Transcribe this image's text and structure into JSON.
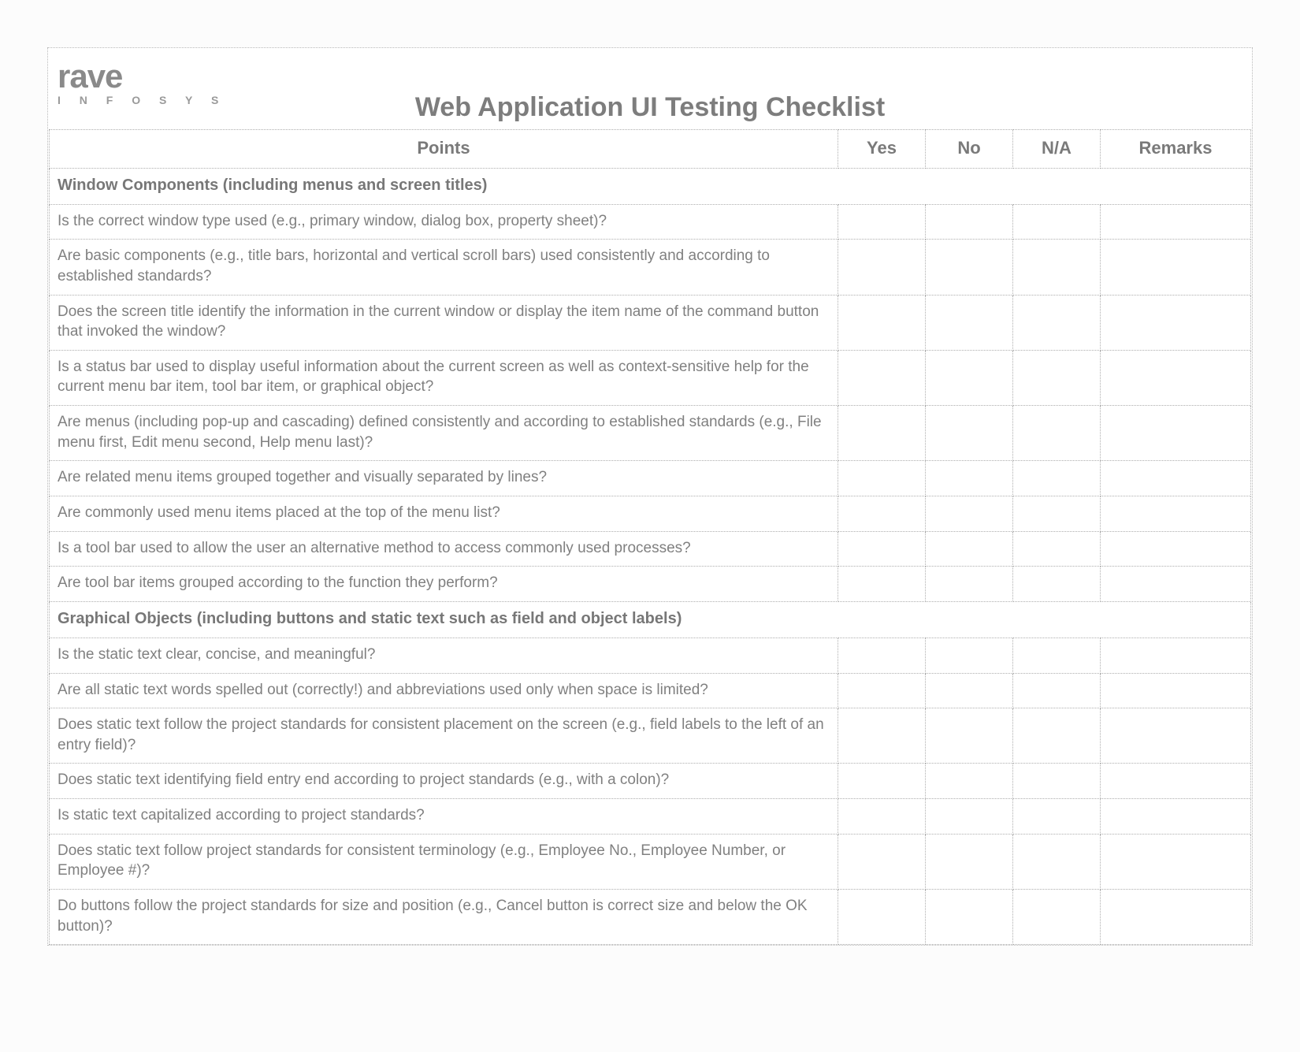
{
  "logo": {
    "main": "rave",
    "sub": "I N F O S Y S"
  },
  "title": "Web Application UI Testing Checklist",
  "headers": {
    "points": "Points",
    "yes": "Yes",
    "no": "No",
    "na": "N/A",
    "remarks": "Remarks"
  },
  "rows": [
    {
      "type": "section",
      "text": "Window Components (including menus and screen titles)"
    },
    {
      "type": "item",
      "text": "Is the correct window type used (e.g., primary window, dialog box, property sheet)?"
    },
    {
      "type": "item",
      "text": "Are basic components (e.g., title bars, horizontal and vertical scroll bars) used consistently and according to established standards?"
    },
    {
      "type": "item",
      "text": "Does the screen title identify the information in the current window or display the item name of the command button that invoked the window?"
    },
    {
      "type": "item",
      "text": "Is a status bar used to display useful information about the current screen as well as context-sensitive help for the current menu bar item, tool bar item, or graphical object?"
    },
    {
      "type": "item",
      "text": "Are menus (including pop-up and cascading) defined consistently and according to established standards (e.g., File menu first, Edit menu second, Help menu last)?"
    },
    {
      "type": "item",
      "text": "Are related menu items grouped together and visually separated by lines?"
    },
    {
      "type": "item",
      "text": "Are commonly used menu items placed at the top of the menu list?"
    },
    {
      "type": "item",
      "text": "Is a tool bar used to allow the user an alternative method to access commonly used processes?"
    },
    {
      "type": "item",
      "text": "Are tool bar items grouped according to the function they perform?"
    },
    {
      "type": "section",
      "text": "Graphical Objects (including buttons and static text such as field and object labels)"
    },
    {
      "type": "item",
      "text": "Is the static text clear, concise, and meaningful?"
    },
    {
      "type": "item",
      "text": "Are all static text words spelled out (correctly!) and abbreviations used only when space is limited?"
    },
    {
      "type": "item",
      "text": "Does static text follow the project standards for consistent placement on the screen (e.g., field labels to the left of an entry field)?"
    },
    {
      "type": "item",
      "text": "Does static text identifying field entry end according to project standards (e.g., with a colon)?"
    },
    {
      "type": "item",
      "text": "Is static text capitalized according to project standards?"
    },
    {
      "type": "item",
      "text": "Does static text follow project standards for consistent terminology (e.g., Employee No., Employee Number, or Employee #)?"
    },
    {
      "type": "item",
      "text": "Do buttons follow the project standards for size and position (e.g., Cancel button is correct size and below the OK button)?"
    }
  ]
}
